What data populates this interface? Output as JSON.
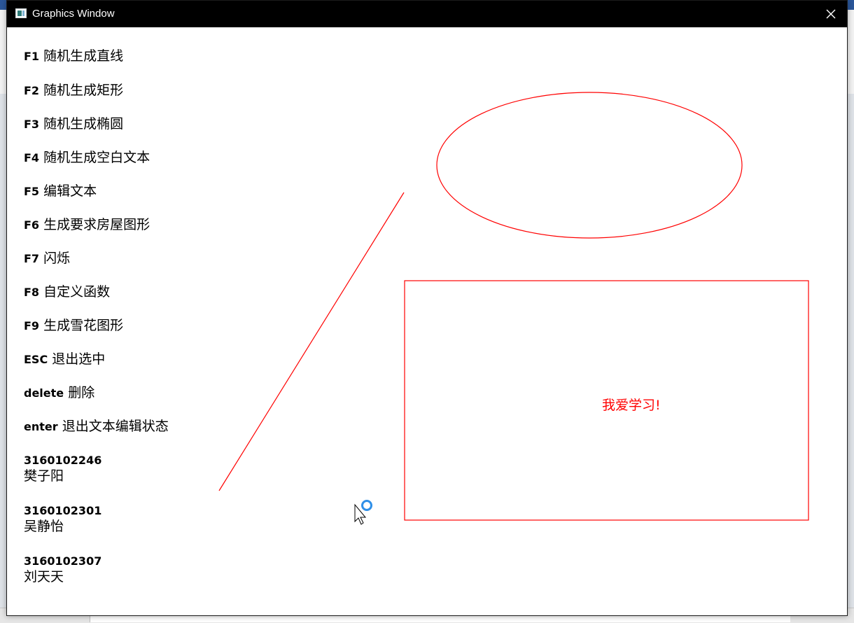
{
  "window": {
    "title": "Graphics Window",
    "app_icon": "graphics-window-app-icon",
    "close_icon": "close-icon"
  },
  "menu": [
    {
      "key": "F1",
      "label": "随机生成直线"
    },
    {
      "key": "F2",
      "label": "随机生成矩形"
    },
    {
      "key": "F3",
      "label": "随机生成椭圆"
    },
    {
      "key": "F4",
      "label": "随机生成空白文本"
    },
    {
      "key": "F5",
      "label": "编辑文本"
    },
    {
      "key": "F6",
      "label": "生成要求房屋图形"
    },
    {
      "key": "F7",
      "label": "闪烁"
    },
    {
      "key": "F8",
      "label": "自定义函数"
    },
    {
      "key": "F9",
      "label": "生成雪花图形"
    },
    {
      "key": "ESC",
      "label": "退出选中"
    },
    {
      "key": "delete",
      "label": "删除"
    },
    {
      "key": "enter",
      "label": "退出文本编辑状态"
    }
  ],
  "students": [
    {
      "id": "3160102246",
      "name": "樊子阳"
    },
    {
      "id": "3160102301",
      "name": "吴静怡"
    },
    {
      "id": "3160102307",
      "name": "刘天天"
    }
  ],
  "canvas": {
    "rect_text": "我爱学习!",
    "stroke_color": "#ff0000",
    "cursor": "busy-arrow-cursor-icon"
  }
}
